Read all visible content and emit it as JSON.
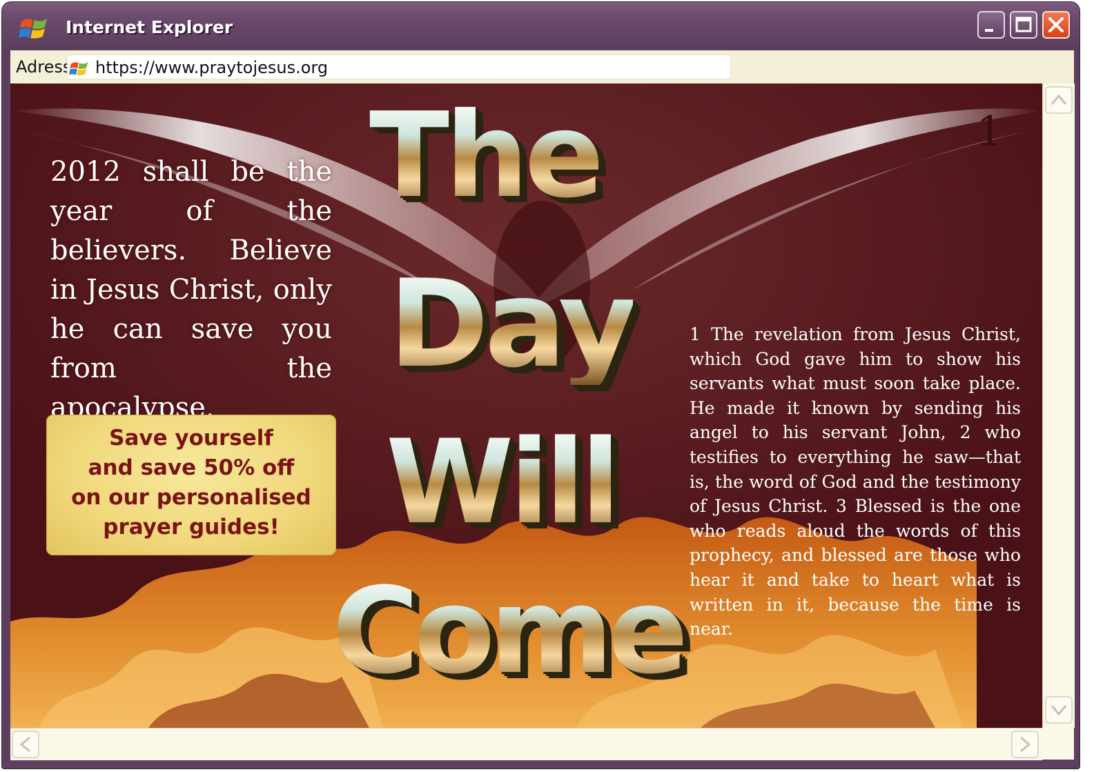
{
  "window": {
    "title": "Internet Explorer"
  },
  "address_bar": {
    "label": "Adress",
    "url": "https://www.praytojesus.org"
  },
  "page": {
    "headline": [
      "The",
      "Day",
      "Will",
      "Come"
    ],
    "left_paragraph": "2012 shall be the year of the believers. Believe in Jesus Christ, only he can save you from the apocalypse.",
    "promo": {
      "lines": [
        "Save yourself",
        "and save 50% off",
        "on our personalised",
        "prayer guides!"
      ]
    },
    "verse_number": "1",
    "scripture": "1 The revelation from Jesus Christ, which God gave him to show his servants what must soon take place. He made it known by sending his angel to his servant John, 2 who testifies to everything he saw—that is, the word of God and the testimony of Jesus Christ. 3 Blessed is the one who reads aloud the words of this prophecy, and blessed are those who hear it and take to heart what is written in it, because the time is near."
  },
  "icons": {
    "window_logo": "windows-flag-icon",
    "address_icon": "windows-flag-icon",
    "minimize": "minimize-icon",
    "maximize": "maximize-icon",
    "close": "close-icon",
    "scroll_up": "chevron-up-icon",
    "scroll_down": "chevron-down-icon",
    "scroll_left": "chevron-left-icon",
    "scroll_right": "chevron-right-icon"
  },
  "colors": {
    "titlebar": "#6a4a6c",
    "address_bar": "#f4f0d8",
    "page_background": "#4a1117",
    "promo_text": "#7a1414",
    "promo_background": "#f0d77a",
    "close_button": "#d8401c"
  }
}
